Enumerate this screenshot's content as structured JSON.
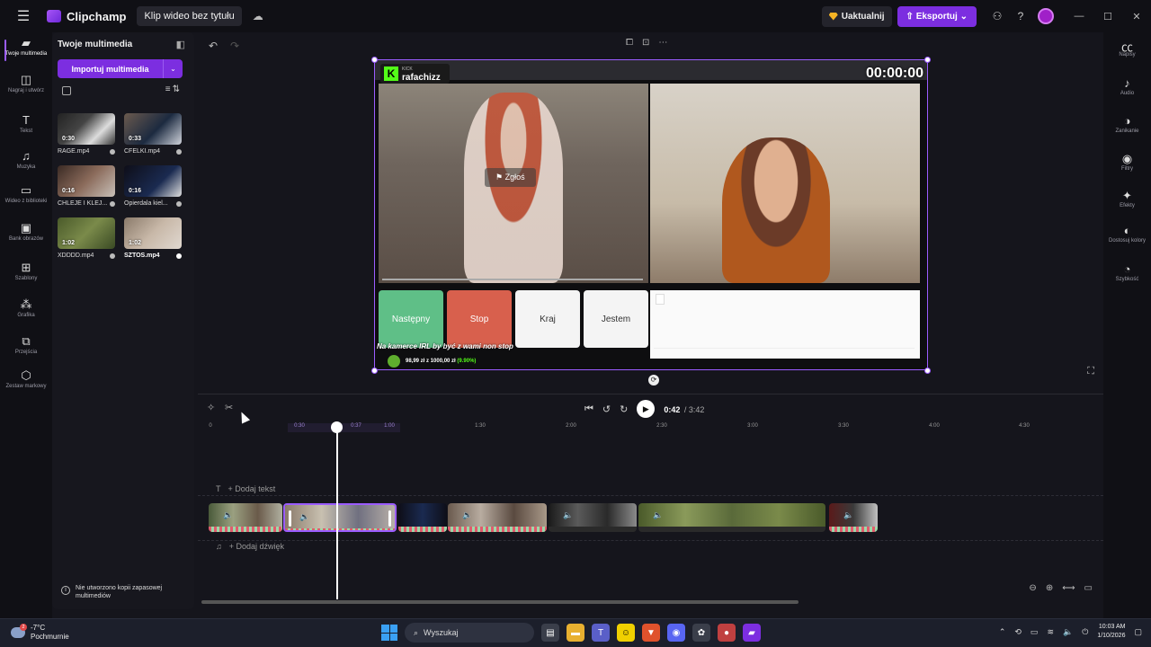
{
  "titlebar": {
    "app_name": "Clipchamp",
    "project_title": "Klip wideo bez tytułu",
    "upgrade_label": "Uaktualnij",
    "export_label": "Eksportuj",
    "help_label": "?"
  },
  "rail": [
    {
      "label": "Twoje multimedia",
      "icon": "media-icon"
    },
    {
      "label": "Nagraj i utwórz",
      "icon": "record-icon"
    },
    {
      "label": "Tekst",
      "icon": "text-icon"
    },
    {
      "label": "Muzyka",
      "icon": "music-icon"
    },
    {
      "label": "Wideo z biblioteki",
      "icon": "video-library-icon"
    },
    {
      "label": "Bank obrazów",
      "icon": "image-bank-icon"
    },
    {
      "label": "Szablony",
      "icon": "templates-icon"
    },
    {
      "label": "Grafika",
      "icon": "graphics-icon"
    },
    {
      "label": "Przejścia",
      "icon": "transitions-icon"
    },
    {
      "label": "Zestaw markowy",
      "icon": "brand-kit-icon"
    }
  ],
  "media": {
    "title": "Twoje multimedia",
    "import_label": "Importuj multimedia",
    "items": [
      {
        "name": "RAGE.mp4",
        "duration": "0:30"
      },
      {
        "name": "CFELKI.mp4",
        "duration": "0:33"
      },
      {
        "name": "CHLEJE I KLEJ...",
        "duration": "0:16"
      },
      {
        "name": "Opierdala kiel...",
        "duration": "0:16"
      },
      {
        "name": "XDDDD.mp4",
        "duration": "1:02"
      },
      {
        "name": "SZTOS.mp4",
        "duration": "1:02"
      }
    ],
    "backup_notice": "Nie utworzono kopii zapasowej multimediów"
  },
  "preview": {
    "streamer_small": "KICK",
    "streamer_name": "rafachizz",
    "timer": "00:00:00",
    "report_label": "Zgłoś",
    "buttons": [
      "Następny",
      "Stop",
      "Kraj",
      "Jestem"
    ],
    "ticker": "Na kamerce IRL by być z wami non stop",
    "donation_text": "98,99 zł z 1000,00 zł",
    "donation_pct": "(9.90%)"
  },
  "right_rail": [
    {
      "label": "Napisy",
      "icon": "captions-icon"
    },
    {
      "label": "Audio",
      "icon": "audio-icon"
    },
    {
      "label": "Zanikanie",
      "icon": "fade-icon"
    },
    {
      "label": "Filtry",
      "icon": "filters-icon"
    },
    {
      "label": "Efekty",
      "icon": "effects-icon"
    },
    {
      "label": "Dostosuj kolory",
      "icon": "adjust-colors-icon"
    },
    {
      "label": "Szybkość",
      "icon": "speed-icon"
    }
  ],
  "timeline": {
    "current_time": "0:42",
    "total_time": "/ 3:42",
    "ruler_ticks": [
      "0",
      "0:30",
      "0:37",
      "1:00",
      "1:30",
      "2:00",
      "2:30",
      "3:00",
      "3:30",
      "4:00",
      "4:30"
    ],
    "add_text": "+ Dodaj tekst",
    "add_audio": "+ Dodaj dźwięk"
  },
  "taskbar": {
    "temperature": "-7°C",
    "weather": "Pochmurnie",
    "weather_badge": "2",
    "search_label": "Wyszukaj",
    "time": "10:03 AM",
    "date": "1/10/2026"
  },
  "colors": {
    "accent": "#7c2ee0",
    "selection": "#9b5cff",
    "next_button": "#5fbf87",
    "stop_button": "#d8604d"
  }
}
